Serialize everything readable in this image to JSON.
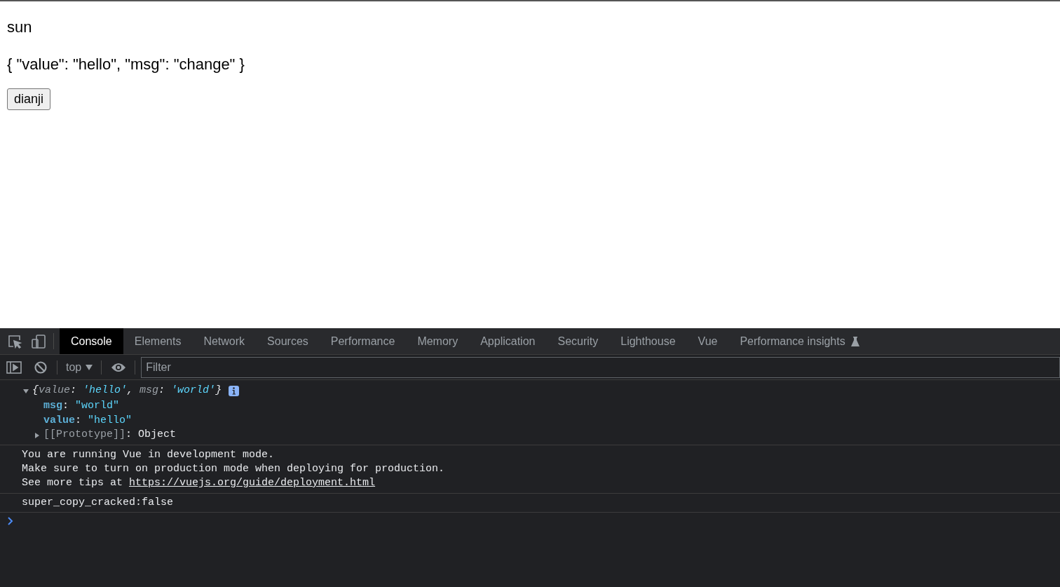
{
  "page": {
    "heading": "sun",
    "json_text": "{ \"value\": \"hello\", \"msg\": \"change\" }",
    "button": "dianji"
  },
  "devtools": {
    "tabs": [
      {
        "label": "Console",
        "selected": true
      },
      {
        "label": "Elements",
        "selected": false
      },
      {
        "label": "Network",
        "selected": false
      },
      {
        "label": "Sources",
        "selected": false
      },
      {
        "label": "Performance",
        "selected": false
      },
      {
        "label": "Memory",
        "selected": false
      },
      {
        "label": "Application",
        "selected": false
      },
      {
        "label": "Security",
        "selected": false
      },
      {
        "label": "Lighthouse",
        "selected": false
      },
      {
        "label": "Vue",
        "selected": false
      },
      {
        "label": "Performance insights",
        "selected": false,
        "experimental": true
      }
    ],
    "context": "top",
    "filter": {
      "placeholder": "Filter"
    },
    "console": {
      "object": {
        "expanded": true,
        "summary": [
          {
            "kind": "punct",
            "text": "{"
          },
          {
            "kind": "key",
            "text": "value"
          },
          {
            "kind": "punct",
            "text": ": "
          },
          {
            "kind": "string",
            "text": "'hello'"
          },
          {
            "kind": "punct",
            "text": ", "
          },
          {
            "kind": "key",
            "text": "msg"
          },
          {
            "kind": "punct",
            "text": ": "
          },
          {
            "kind": "string",
            "text": "'world'"
          },
          {
            "kind": "punct",
            "text": "}"
          }
        ],
        "properties": [
          {
            "key": "msg",
            "sep": ": ",
            "value": "\"world\""
          },
          {
            "key": "value",
            "sep": ": ",
            "value": "\"hello\""
          }
        ],
        "prototype": {
          "label": "[[Prototype]]",
          "sep": ": ",
          "value": "Object",
          "expanded": false
        }
      },
      "message": {
        "lines": [
          "You are running Vue in development mode.",
          "Make sure to turn on production mode when deploying for production."
        ],
        "link_prefix": "See more tips at ",
        "link": "https://vuejs.org/guide/deployment.html"
      },
      "log": "super_copy_cracked:false"
    }
  }
}
